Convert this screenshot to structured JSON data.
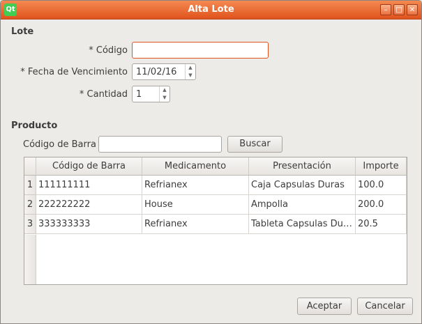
{
  "window": {
    "title": "Alta Lote",
    "logo": "Qt"
  },
  "lote": {
    "section_title": "Lote",
    "codigo_label": "* Código",
    "codigo_value": "",
    "fecha_label": "* Fecha de Vencimiento",
    "fecha_value": "11/02/16",
    "cantidad_label": "* Cantidad",
    "cantidad_value": "1"
  },
  "producto": {
    "section_title": "Producto",
    "barcode_label": "Código de Barra",
    "barcode_value": "",
    "search_label": "Buscar"
  },
  "table": {
    "columns": [
      "Código de Barra",
      "Medicamento",
      "Presentación",
      "Importe"
    ],
    "rows": [
      {
        "num": "1",
        "codigo": "111111111",
        "medicamento": "Refrianex",
        "presentacion": "Caja Capsulas Duras",
        "importe": "100.0"
      },
      {
        "num": "2",
        "codigo": "222222222",
        "medicamento": "House",
        "presentacion": "Ampolla",
        "importe": "200.0"
      },
      {
        "num": "3",
        "codigo": "333333333",
        "medicamento": "Refrianex",
        "presentacion": "Tableta Capsulas Du…",
        "importe": "20.5"
      }
    ]
  },
  "footer": {
    "accept_label": "Aceptar",
    "cancel_label": "Cancelar"
  },
  "colors": {
    "titlebar": "#e0531d",
    "focus": "#e0531d"
  }
}
